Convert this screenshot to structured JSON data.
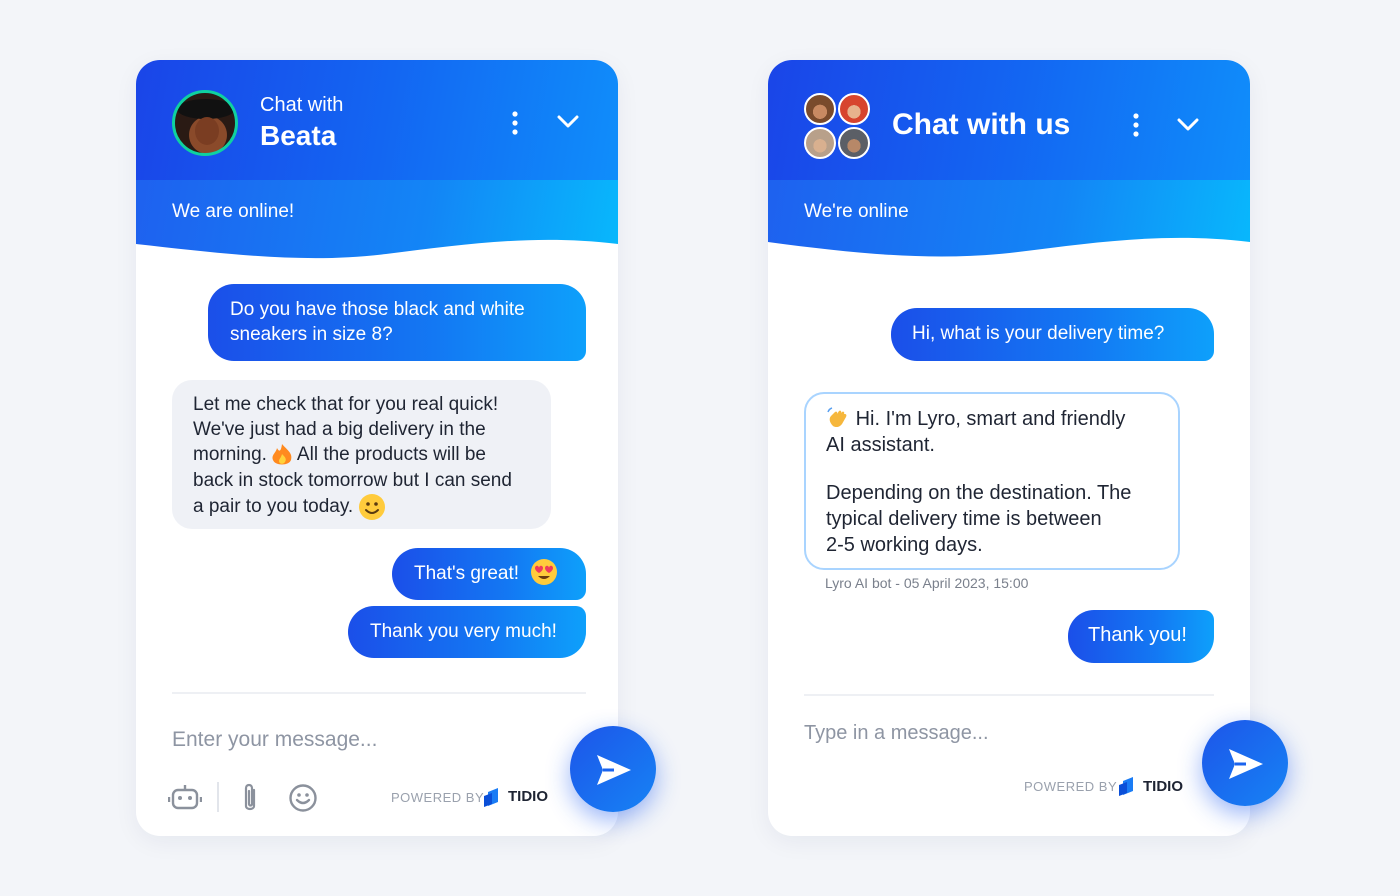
{
  "widget_left": {
    "header": {
      "title_small": "Chat with",
      "title_big": "Beata",
      "status": "We are online!"
    },
    "messages": [
      {
        "from": "visitor",
        "text": "Do you have those black and white sneakers in size 8?"
      },
      {
        "from": "agent",
        "line1": "Let me check that for you real quick!",
        "line2": "We've just had a big delivery in the",
        "line3a": "morning.",
        "line3b": "All the products will be",
        "line4": "back in stock tomorrow but I can send",
        "line5": "a pair to you today."
      },
      {
        "from": "visitor",
        "text": "That's great!"
      },
      {
        "from": "visitor",
        "text": "Thank you very much!"
      }
    ],
    "input_placeholder": "Enter your message...",
    "powered_by": "POWERED BY",
    "brand": "TIDIO",
    "icons": [
      "bot-icon",
      "paperclip-icon",
      "smiley-icon",
      "send-icon",
      "more-vertical-icon",
      "chevron-down-icon"
    ]
  },
  "widget_right": {
    "header": {
      "title": "Chat with us",
      "status": "We're online"
    },
    "messages": [
      {
        "from": "visitor",
        "text": "Hi, what is your delivery time?"
      },
      {
        "from": "bot",
        "line1": "Hi. I'm Lyro, smart and friendly",
        "line2": "AI assistant.",
        "line3": "Depending on the destination. The",
        "line4": "typical delivery time is between",
        "line5": "2-5 working days.",
        "meta": "Lyro AI bot - 05 April 2023, 15:00"
      },
      {
        "from": "visitor",
        "text": "Thank you!"
      }
    ],
    "input_placeholder": "Type in a message...",
    "powered_by": "POWERED BY",
    "brand": "TIDIO"
  },
  "colors": {
    "accent": "#1366f2",
    "accent_light": "#0ea0fb",
    "page_bg": "#f3f5f9",
    "agent_bubble": "#eff1f6",
    "bot_border": "#a9d4ff"
  }
}
